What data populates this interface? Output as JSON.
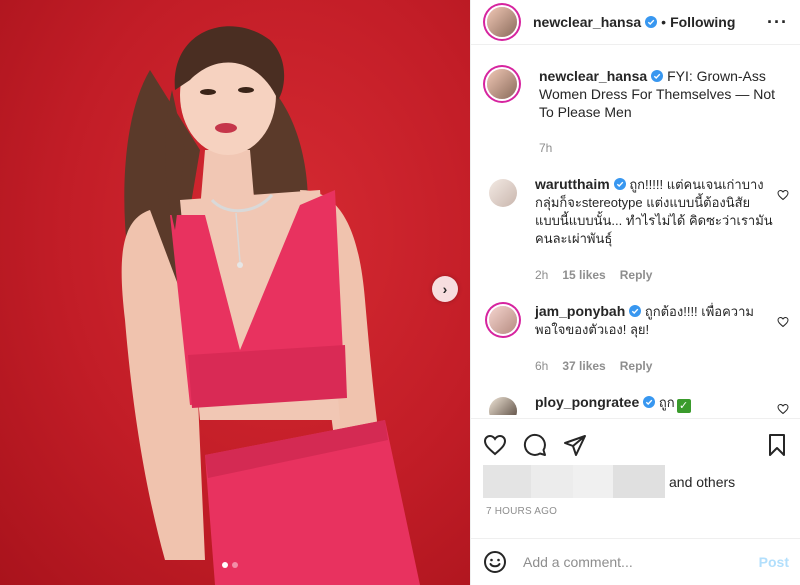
{
  "post": {
    "carousel_dots": 2,
    "active_dot": 0
  },
  "header": {
    "username": "newclear_hansa",
    "separator": "•",
    "follow_status": "Following",
    "more_icon": "more-horizontal-icon"
  },
  "caption": {
    "username": "newclear_hansa",
    "text": "FYI: Grown-Ass Women Dress For Themselves — Not To Please Men",
    "time": "7h"
  },
  "comments": [
    {
      "username": "warutthaim",
      "text": "ถูก!!!!! แต่คนเจนเก่าบางกลุ่มก็จะstereotype แต่งแบบนี้ต้องนิสัยแบบนี้แบบนั้น... ทำไรไม่ได้ คิดซะว่าเรามันคนละเผ่าพันธุ์",
      "time": "2h",
      "likes": "15 likes",
      "reply": "Reply"
    },
    {
      "username": "jam_ponybah",
      "text": "ถูกต้อง!!!! เพื่อความพอใจของตัวเอง! ลุย!",
      "time": "6h",
      "likes": "37 likes",
      "reply": "Reply"
    },
    {
      "username": "ploy_pongratee",
      "text": "ถูก",
      "emoji": "✓"
    }
  ],
  "likes": {
    "suffix": "and others"
  },
  "timestamp": "7 HOURS AGO",
  "add_comment": {
    "placeholder": "Add a comment...",
    "post_label": "Post"
  },
  "colors": {
    "verified": "#3897f0",
    "story_ring": "#d6249f",
    "post_disabled": "#b2dffc",
    "photo_background": "#c21d27",
    "outfit": "#e8325f"
  }
}
